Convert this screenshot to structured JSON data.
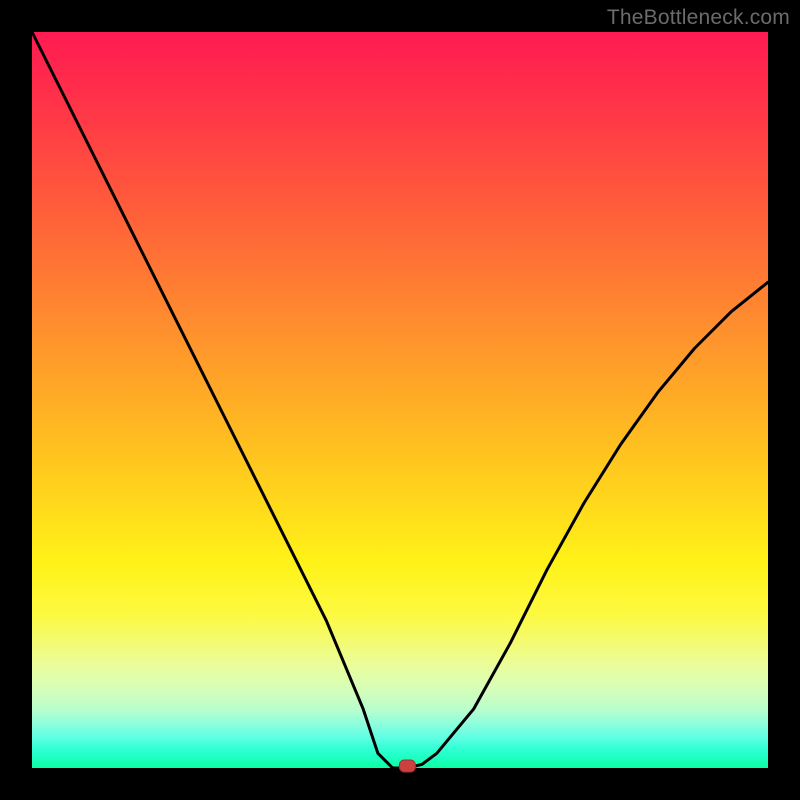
{
  "watermark": "TheBottleneck.com",
  "chart_data": {
    "type": "line",
    "title": "",
    "xlabel": "",
    "ylabel": "",
    "xlim": [
      0,
      100
    ],
    "ylim": [
      0,
      100
    ],
    "grid": false,
    "legend": false,
    "series": [
      {
        "name": "bottleneck-curve",
        "x": [
          0,
          5,
          10,
          15,
          20,
          25,
          30,
          35,
          40,
          45,
          47,
          49,
          51,
          53,
          55,
          60,
          65,
          70,
          75,
          80,
          85,
          90,
          95,
          100
        ],
        "y": [
          100,
          90,
          80,
          70,
          60,
          50,
          40,
          30,
          20,
          8,
          2,
          0,
          0,
          0.5,
          2,
          8,
          17,
          27,
          36,
          44,
          51,
          57,
          62,
          66
        ]
      }
    ],
    "marker": {
      "x": 51,
      "y": 0,
      "color": "#cc4040"
    },
    "background_gradient": {
      "top": "#ff1b52",
      "mid": "#fff218",
      "bottom": "#0cffa2"
    }
  }
}
